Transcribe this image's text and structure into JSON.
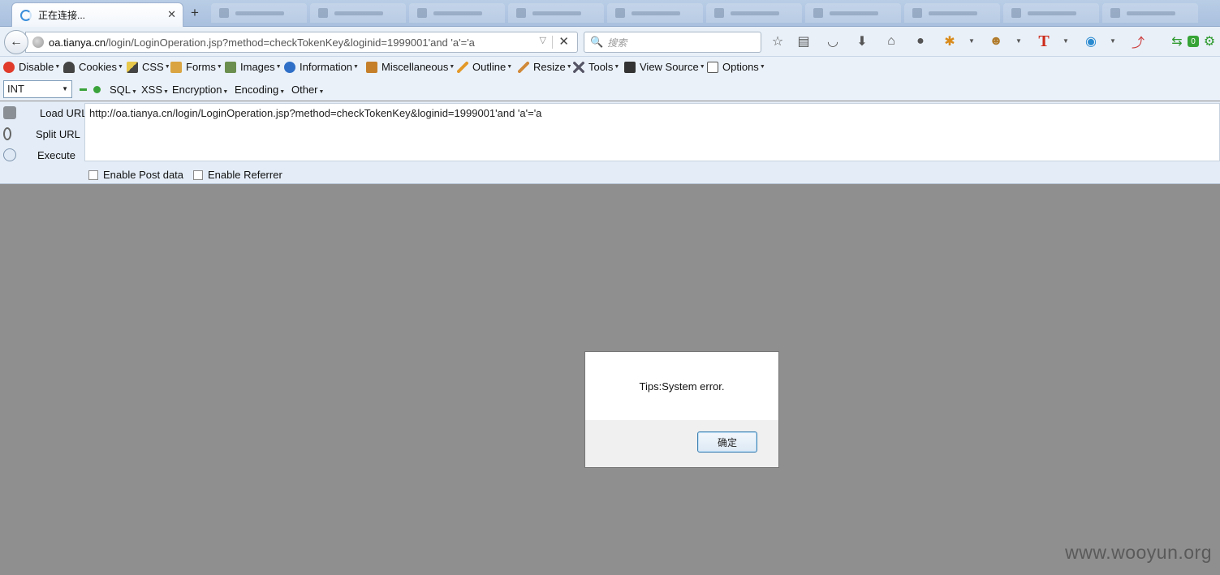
{
  "tab": {
    "title": "正在连接...",
    "close": "✕",
    "new_tab": "+"
  },
  "navbar": {
    "url_domain": "oa.tianya.cn",
    "url_path": "/login/LoginOperation.jsp?method=checkTokenKey&loginid=1999001'and 'a'='a",
    "search_placeholder": "搜索",
    "badge": "0"
  },
  "devbar": {
    "items": [
      "Disable",
      "Cookies",
      "CSS",
      "Forms",
      "Images",
      "Information",
      "Miscellaneous",
      "Outline",
      "Resize",
      "Tools",
      "View Source",
      "Options"
    ]
  },
  "hackbar": {
    "select_value": "INT",
    "menus": [
      "SQL",
      "XSS",
      "Encryption",
      "Encoding",
      "Other"
    ],
    "actions": [
      "Load URL",
      "Split URL",
      "Execute"
    ],
    "url_value": "http://oa.tianya.cn/login/LoginOperation.jsp?method=checkTokenKey&loginid=1999001'and 'a'='a",
    "enable_post": "Enable Post data",
    "enable_referrer": "Enable Referrer"
  },
  "dialog": {
    "message": "Tips:System error.",
    "ok_label": "确定"
  },
  "watermark": "www.wooyun.org",
  "icons": {
    "back": "back-arrow-icon",
    "globe": "globe-icon",
    "search": "search-icon",
    "bookmark": "star-icon",
    "reader": "reader-icon",
    "pocket": "pocket-icon",
    "download": "download-icon",
    "home": "home-icon",
    "chat": "chat-icon",
    "loading": "spinner-icon"
  },
  "colors": {
    "accent": "#3a8edb",
    "content_bg": "#8f8f8f",
    "toolbar_bg": "#eaf1f9"
  }
}
